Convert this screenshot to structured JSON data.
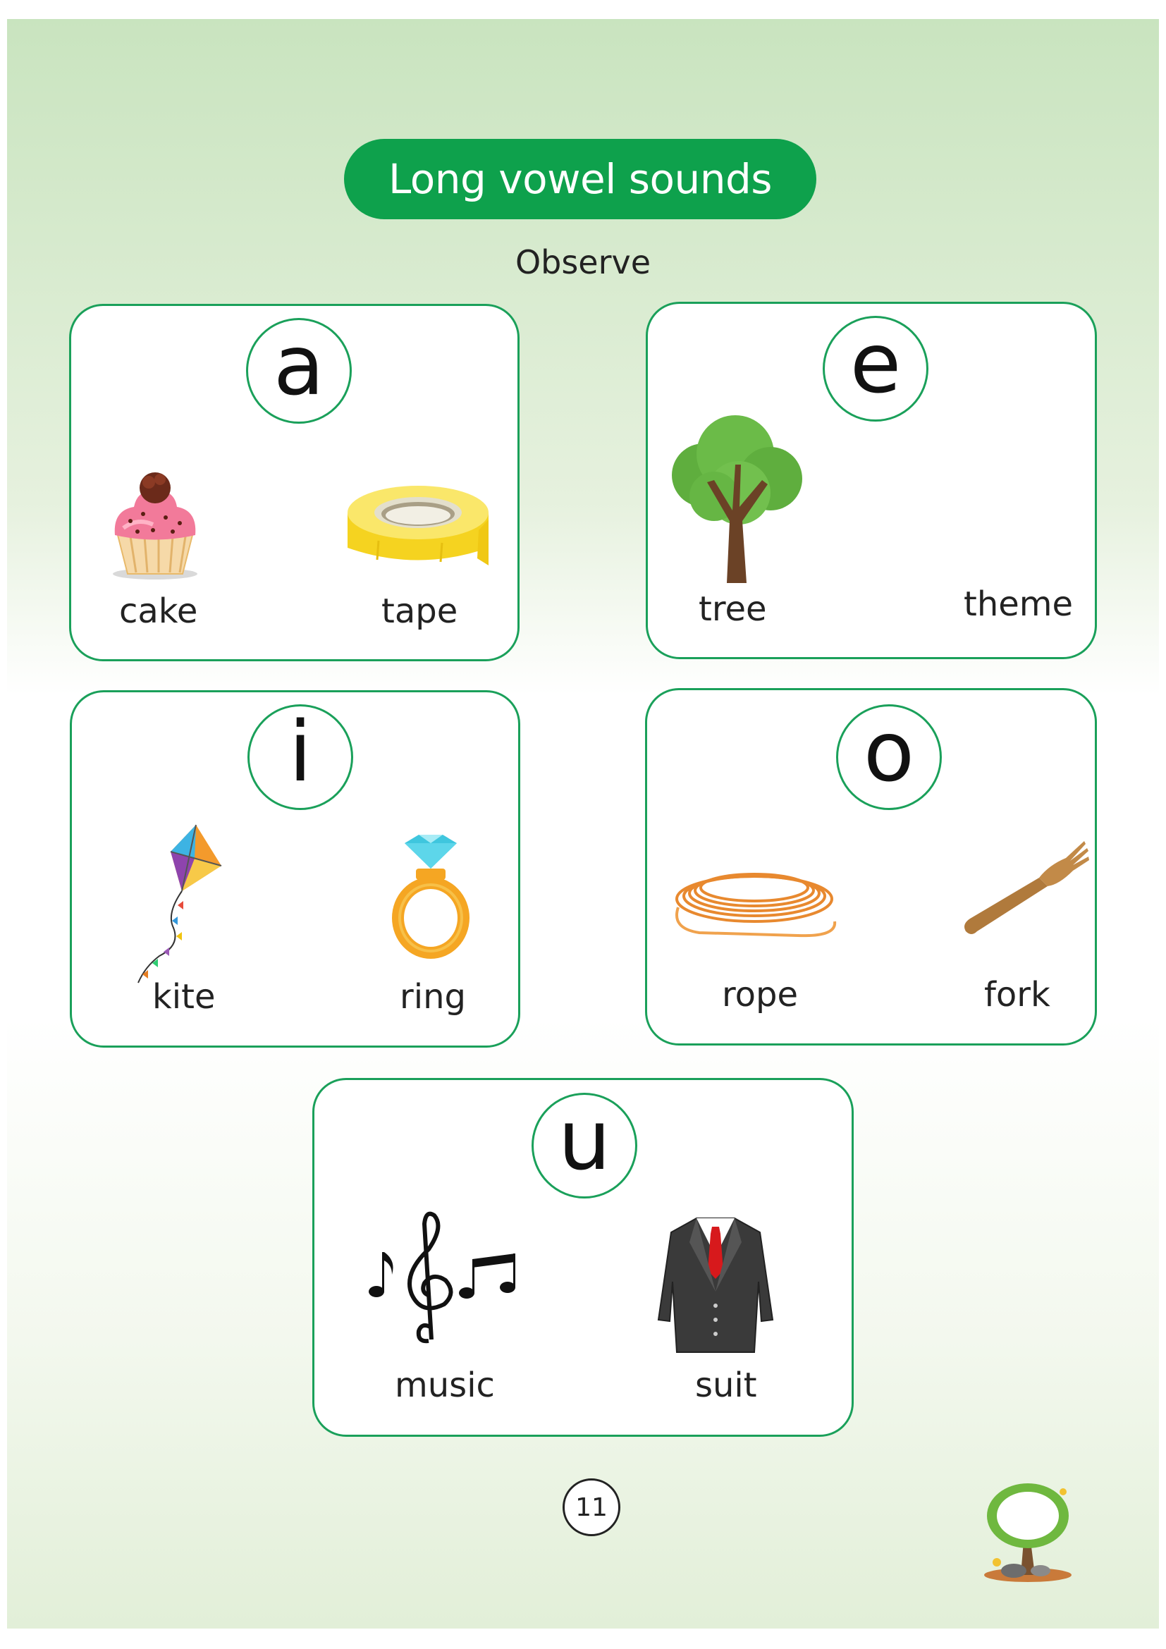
{
  "title": "Long vowel sounds",
  "subtitle": "Observe",
  "cards": [
    {
      "vowel": "a",
      "words": [
        "cake",
        "tape"
      ]
    },
    {
      "vowel": "e",
      "words": [
        "tree",
        "theme"
      ]
    },
    {
      "vowel": "i",
      "words": [
        "kite",
        "ring"
      ]
    },
    {
      "vowel": "o",
      "words": [
        "rope",
        "fork"
      ]
    },
    {
      "vowel": "u",
      "words": [
        "music",
        "suit"
      ]
    }
  ],
  "page_number": "11",
  "colors": {
    "accent": "#0ea14c",
    "border": "#1aa05a",
    "background_top": "#c9e4bf"
  },
  "icons": [
    "cupcake-icon",
    "tape-roll-icon",
    "tree-icon",
    "kite-icon",
    "diamond-ring-icon",
    "rope-coil-icon",
    "wooden-fork-icon",
    "music-notes-icon",
    "suit-icon",
    "tree-mascot-icon"
  ]
}
